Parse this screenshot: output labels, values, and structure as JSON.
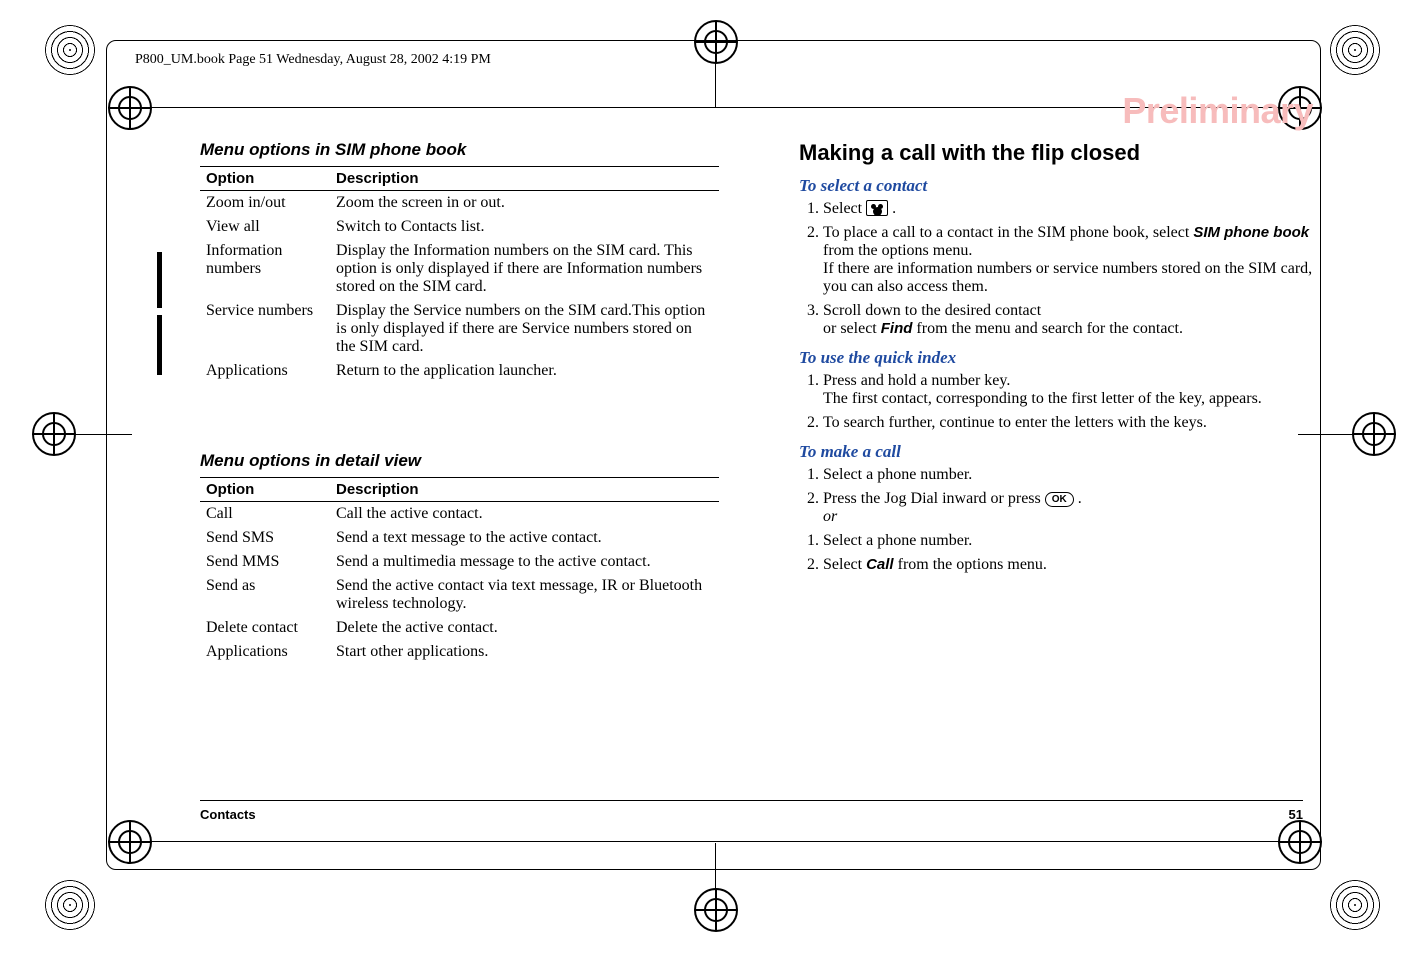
{
  "header_running": "P800_UM.book  Page 51  Wednesday, August 28, 2002  4:19 PM",
  "watermark": "Preliminary",
  "footer": {
    "section": "Contacts",
    "page": "51"
  },
  "left": {
    "section1_title": "Menu options in SIM phone book",
    "table1": {
      "th_option": "Option",
      "th_desc": "Description",
      "rows": [
        {
          "opt": "Zoom in/out",
          "desc": "Zoom the screen in or out."
        },
        {
          "opt": "View all",
          "desc": "Switch to Contacts list."
        },
        {
          "opt": "Information numbers",
          "desc": "Display the Information numbers on the SIM card. This option is only displayed if there are Information numbers stored on the SIM card."
        },
        {
          "opt": "Service numbers",
          "desc": "Display the Service numbers on the SIM card.This option is only displayed if there are Service numbers stored on the SIM card."
        },
        {
          "opt": "Applications",
          "desc": "Return to the application launcher."
        }
      ]
    },
    "section2_title": "Menu options in detail view",
    "table2": {
      "th_option": "Option",
      "th_desc": "Description",
      "rows": [
        {
          "opt": "Call",
          "desc": "Call the active contact."
        },
        {
          "opt": "Send SMS",
          "desc": "Send a text message to the active contact."
        },
        {
          "opt": "Send MMS",
          "desc": "Send a multimedia message to the active contact."
        },
        {
          "opt": "Send as",
          "desc": "Send the active contact via text message, IR or Bluetooth wireless technology."
        },
        {
          "opt": "Delete contact",
          "desc": "Delete the active contact."
        },
        {
          "opt": "Applications",
          "desc": "Start other applications."
        }
      ]
    }
  },
  "right": {
    "heading": "Making a call with the flip closed",
    "sec1_title": "To select a contact",
    "sec1": {
      "step1_pre": "Select ",
      "step1_post": " .",
      "step2_pre": "To place a call to a contact in the SIM phone book, select ",
      "step2_bold": "SIM phone book",
      "step2_post": " from the options menu.",
      "step2_note": "If there are information numbers or service numbers stored on the SIM card, you can also access them.",
      "step3_a": "Scroll down to the desired contact",
      "step3_b_pre": "or select ",
      "step3_b_bold": "Find",
      "step3_b_post": " from the menu and search for the contact."
    },
    "sec2_title": "To use the quick index",
    "sec2": {
      "step1": "Press and hold a number key.",
      "step1_note": "The first contact, corresponding to the first letter of the key, appears.",
      "step2": "To search further, continue to enter the letters with the keys."
    },
    "sec3_title": "To make a call",
    "sec3": {
      "step1": "Select a phone number.",
      "step2_pre": "Press the Jog Dial inward or press ",
      "step2_post": ".",
      "or": "or",
      "step3": "Select a phone number.",
      "step4_pre": "Select ",
      "step4_bold": "Call",
      "step4_post": " from the options menu."
    },
    "ok_label": "OK"
  }
}
